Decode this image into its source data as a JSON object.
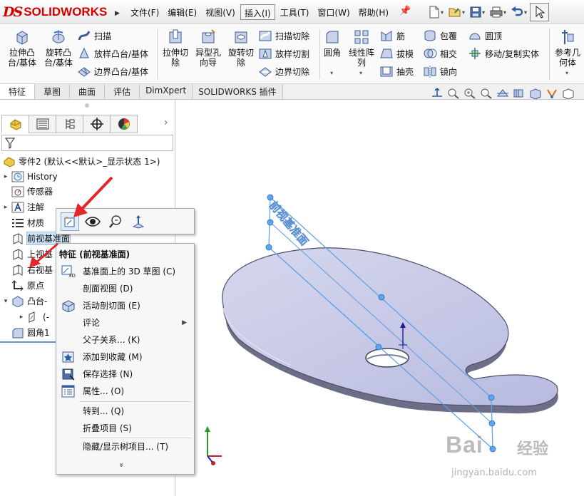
{
  "app": {
    "logo_ds": "DS",
    "logo_text": "SOLIDWORKS"
  },
  "menubar": {
    "items": [
      "文件(F)",
      "编辑(E)",
      "视图(V)",
      "插入(I)",
      "工具(T)",
      "窗口(W)",
      "帮助(H)"
    ],
    "active": "插入(I)"
  },
  "quick_access": [
    "new-icon",
    "open-icon",
    "save-icon",
    "print-icon",
    "undo-icon",
    "select-icon"
  ],
  "ribbon": {
    "extrude_boss": "拉伸凸\n台/基体",
    "revolve_boss": "旋转凸\n台/基体",
    "sweep": "扫描",
    "loft_boss": "放样凸台/基体",
    "boundary_boss": "边界凸台/基体",
    "extrude_cut": "拉伸切\n除",
    "hole_wizard": "异型孔\n向导",
    "revolve_cut": "旋转切\n除",
    "swept_cut": "扫描切除",
    "lofted_cut": "放样切割",
    "boundary_cut": "边界切除",
    "fillet": "圆角",
    "linear_pattern": "线性阵\n列",
    "rib": "筋",
    "draft": "拔模",
    "shell": "抽壳",
    "wrap": "包覆",
    "intersect": "相交",
    "mirror": "镜向",
    "dome": "圆顶",
    "move_copy": "移动/复制实体",
    "ref_geometry": "参考几\n何体"
  },
  "tabs": [
    "特征",
    "草图",
    "曲面",
    "评估",
    "DimXpert",
    "SOLIDWORKS 插件"
  ],
  "active_tab": "特征",
  "panel_tabs": [
    "feature-manager-icon",
    "property-manager-icon",
    "configuration-manager-icon",
    "dimxpert-icon",
    "display-manager-icon"
  ],
  "tree": {
    "part": "零件2 (默认<<默认>_显示状态 1>)",
    "history": "History",
    "sensors": "传感器",
    "annotations": "注解",
    "material": "材质",
    "front_plane": "前视基准面",
    "top_plane": "上视基",
    "right_plane": "右视基",
    "origin": "原点",
    "boss": "凸台-",
    "sketch": "(-",
    "fillet": "圆角1"
  },
  "context_toolbar": [
    "sketch-icon",
    "eye-icon",
    "zoom-to-selection-icon",
    "normal-to-icon"
  ],
  "context_menu": {
    "header": "特征 (前视基准面)",
    "items": [
      {
        "label": "基准面上的 3D 草图 (C)",
        "icon": "sketch-3d-icon"
      },
      {
        "label": "剖面视图 (D)",
        "icon": ""
      },
      {
        "label": "活动剖切面 (E)",
        "icon": "section-plane-icon"
      },
      {
        "label": "评论",
        "icon": "",
        "submenu": true
      },
      {
        "label": "父子关系... (K)",
        "icon": ""
      },
      {
        "label": "添加到收藏 (M)",
        "icon": "favorite-icon"
      },
      {
        "label": "保存选择 (N)",
        "icon": "save-selection-icon"
      },
      {
        "label": "属性... (O)",
        "icon": "properties-icon"
      },
      {
        "label": "转到... (Q)",
        "icon": ""
      },
      {
        "label": "折叠项目 (S)",
        "icon": ""
      },
      {
        "label": "隐藏/显示树项目... (T)",
        "icon": ""
      }
    ],
    "more": "»"
  },
  "plane_label": "前视基准面",
  "watermark": {
    "logo": "Bai",
    "logo_cn": "经验",
    "url": "jingyan.baidu.com"
  },
  "colors": {
    "accent": "#2f78d0",
    "brand_red": "#d40000",
    "arrow_red": "#e3262a",
    "model_face": "#c6c8e6",
    "plane": "#5a9ee6"
  }
}
